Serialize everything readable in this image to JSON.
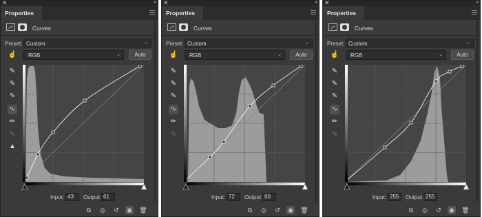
{
  "panels": [
    {
      "tab_title": "Properties",
      "adjustment_title": "Curves",
      "preset_label": "Preset:",
      "preset_value": "Custom",
      "channel_value": "RGB",
      "auto_label": "Auto",
      "input_label": "Input:",
      "input_value": "43",
      "output_label": "Output:",
      "output_value": "61",
      "shows_clipping_tool": true
    },
    {
      "tab_title": "Properties",
      "adjustment_title": "Curves",
      "preset_label": "Preset:",
      "preset_value": "Custom",
      "channel_value": "RGB",
      "auto_label": "Auto",
      "input_label": "Input:",
      "input_value": "72",
      "output_label": "Output:",
      "output_value": "60",
      "shows_clipping_tool": false
    },
    {
      "tab_title": "Properties",
      "adjustment_title": "Curves",
      "preset_label": "Preset:",
      "preset_value": "Custom",
      "channel_value": "RGB",
      "auto_label": "Auto",
      "input_label": "Input:",
      "input_value": "255",
      "output_label": "Output:",
      "output_value": "255",
      "shows_clipping_tool": false
    }
  ],
  "icons": {
    "close": "close-icon",
    "collapse": "collapse-icon",
    "panel_menu": "panel-menu-icon",
    "curves_adjustment": "curves-adjustment-icon",
    "layer_mask": "layer-mask-icon",
    "on_image": "on-image-adjustment-icon",
    "black_eyedropper": "black-point-eyedropper-icon",
    "gray_eyedropper": "gray-point-eyedropper-icon",
    "white_eyedropper": "white-point-eyedropper-icon",
    "curve_points": "edit-points-icon",
    "pencil": "pencil-draw-icon",
    "smooth": "smooth-curve-icon",
    "clipping": "clipping-warning-icon",
    "clip_to_layer": "clip-to-layer-icon",
    "view_previous": "view-previous-state-icon",
    "reset": "reset-icon",
    "visibility": "visibility-eye-icon",
    "delete": "trash-icon"
  },
  "colors": {
    "panel_bg": "#3a3a3a",
    "graph_bg": "#454545",
    "histogram": "#9c9c9c",
    "curve": "#ffffff"
  }
}
